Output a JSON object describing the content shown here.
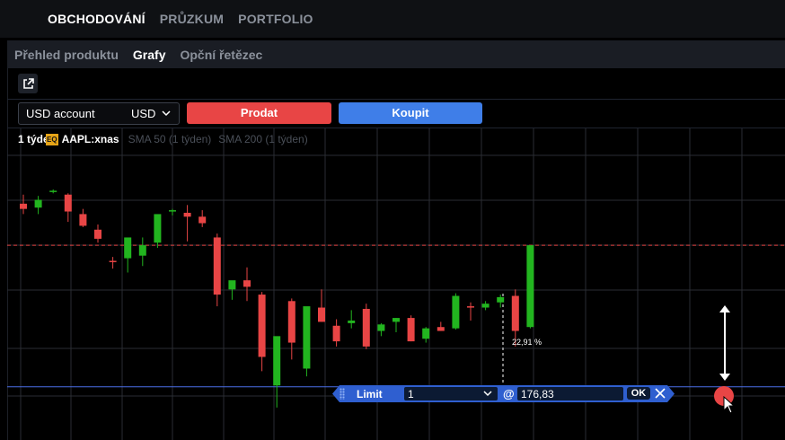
{
  "top_nav": {
    "items": [
      {
        "label": "OBCHODOVÁNÍ",
        "active": true
      },
      {
        "label": "PRŮZKUM",
        "active": false
      },
      {
        "label": "PORTFOLIO",
        "active": false
      }
    ]
  },
  "sub_tabs": {
    "items": [
      {
        "label": "Přehled produktu",
        "active": false
      },
      {
        "label": "Grafy",
        "active": true
      },
      {
        "label": "Opční řetězec",
        "active": false
      }
    ]
  },
  "toolbar": {
    "external_icon": "external-link-icon"
  },
  "order_row": {
    "account_label": "USD account",
    "currency": "USD",
    "sell_label": "Prodat",
    "buy_label": "Koupit",
    "sell_color": "#e84545",
    "buy_color": "#3f7ee8"
  },
  "chart_header": {
    "timeframe": "1 týden",
    "badge": "EQ",
    "symbol": "AAPL:xnas",
    "indicators": [
      "SMA 50 (1 týden)",
      "SMA 200 (1 týden)"
    ]
  },
  "order_ticket": {
    "type": "Limit",
    "quantity": "1",
    "at": "@",
    "price": "176,83",
    "ok_label": "OK",
    "change_pct": "22,91 %"
  },
  "colors": {
    "up": "#22b51f",
    "down": "#e84545",
    "accent": "#3f7ee8",
    "line": "#4b6ee8"
  },
  "chart_data": {
    "type": "candlestick",
    "candles": [
      {
        "o": 171.0,
        "h": 174.5,
        "l": 167.0,
        "c": 169.0
      },
      {
        "o": 169.5,
        "h": 174.0,
        "l": 167.0,
        "c": 172.5
      },
      {
        "o": 175.5,
        "h": 176.5,
        "l": 175.0,
        "c": 176.0
      },
      {
        "o": 174.5,
        "h": 175.0,
        "l": 164.0,
        "c": 168.0
      },
      {
        "o": 167.0,
        "h": 169.0,
        "l": 162.0,
        "c": 162.5
      },
      {
        "o": 161.0,
        "h": 163.0,
        "l": 156.0,
        "c": 157.5
      },
      {
        "o": 149.0,
        "h": 150.5,
        "l": 146.0,
        "c": 148.5
      },
      {
        "o": 150.0,
        "h": 153.0,
        "l": 144.5,
        "c": 158.0
      },
      {
        "o": 151.0,
        "h": 158.0,
        "l": 147.0,
        "c": 155.0
      },
      {
        "o": 156.0,
        "h": 159.5,
        "l": 154.0,
        "c": 167.0
      },
      {
        "o": 168.0,
        "h": 169.0,
        "l": 166.5,
        "c": 168.5
      },
      {
        "o": 167.5,
        "h": 170.5,
        "l": 156.5,
        "c": 166.0
      },
      {
        "o": 166.0,
        "h": 168.5,
        "l": 162.0,
        "c": 163.5
      },
      {
        "o": 158.0,
        "h": 159.5,
        "l": 131.5,
        "c": 136.0
      },
      {
        "o": 138.0,
        "h": 140.5,
        "l": 134.0,
        "c": 141.5
      },
      {
        "o": 141.5,
        "h": 146.5,
        "l": 133.5,
        "c": 139.0
      },
      {
        "o": 136.0,
        "h": 137.0,
        "l": 106.5,
        "c": 112.0
      },
      {
        "o": 101.0,
        "h": 117.5,
        "l": 92.5,
        "c": 120.0
      },
      {
        "o": 133.5,
        "h": 134.5,
        "l": 111.0,
        "c": 117.5
      },
      {
        "o": 107.5,
        "h": 130.0,
        "l": 104.5,
        "c": 131.5
      },
      {
        "o": 131.0,
        "h": 138.0,
        "l": 125.5,
        "c": 125.5
      },
      {
        "o": 124.0,
        "h": 126.5,
        "l": 116.0,
        "c": 118.0
      },
      {
        "o": 125.0,
        "h": 130.0,
        "l": 123.0,
        "c": 126.0
      },
      {
        "o": 130.5,
        "h": 132.5,
        "l": 115.0,
        "c": 116.0
      },
      {
        "o": 122.0,
        "h": 125.0,
        "l": 120.0,
        "c": 124.5
      },
      {
        "o": 125.5,
        "h": 127.0,
        "l": 121.5,
        "c": 127.0
      },
      {
        "o": 127.0,
        "h": 128.0,
        "l": 118.0,
        "c": 118.0
      },
      {
        "o": 119.0,
        "h": 123.5,
        "l": 117.5,
        "c": 123.0
      },
      {
        "o": 123.5,
        "h": 125.5,
        "l": 122.0,
        "c": 122.0
      },
      {
        "o": 123.0,
        "h": 136.5,
        "l": 122.5,
        "c": 135.5
      },
      {
        "o": 131.5,
        "h": 133.0,
        "l": 126.0,
        "c": 131.0
      },
      {
        "o": 131.0,
        "h": 133.5,
        "l": 130.0,
        "c": 132.5
      },
      {
        "o": 133.0,
        "h": 136.0,
        "l": 131.0,
        "c": 135.0
      },
      {
        "o": 135.5,
        "h": 138.0,
        "l": 116.0,
        "c": 122.0
      },
      {
        "o": 123.5,
        "h": 155.0,
        "l": 123.0,
        "c": 155.0
      }
    ],
    "ylim": [
      80,
      200
    ],
    "reference_lines": [
      {
        "value": 155.0,
        "color": "#e84545",
        "style": "dashed"
      },
      {
        "value": 100.5,
        "color": "#4b6ee8",
        "style": "solid"
      }
    ],
    "grid": true
  }
}
